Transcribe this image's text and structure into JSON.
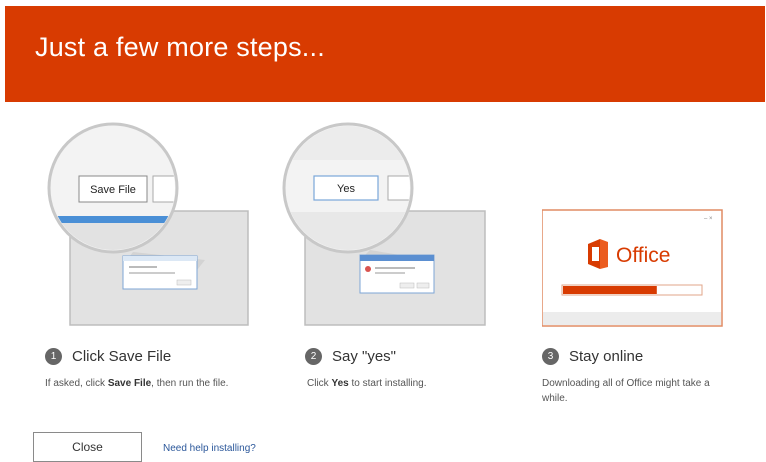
{
  "header": {
    "title": "Just a few more steps..."
  },
  "steps": [
    {
      "number": "1",
      "title": "Click Save File",
      "desc_pre": "If asked, click ",
      "desc_bold": "Save File",
      "desc_post": ", then run the file.",
      "callout_button": "Save File"
    },
    {
      "number": "2",
      "title": "Say \"yes\"",
      "desc_pre": "Click ",
      "desc_bold": "Yes",
      "desc_post": " to start installing.",
      "callout_button": "Yes"
    },
    {
      "number": "3",
      "title": "Stay online",
      "desc": "Downloading all of Office might take a while.",
      "app_name": "Office",
      "progress": 0.68
    }
  ],
  "footer": {
    "close_label": "Close",
    "help_link": "Need help installing?"
  },
  "colors": {
    "brand": "#d83b01",
    "accent_blue": "#2b579a"
  }
}
